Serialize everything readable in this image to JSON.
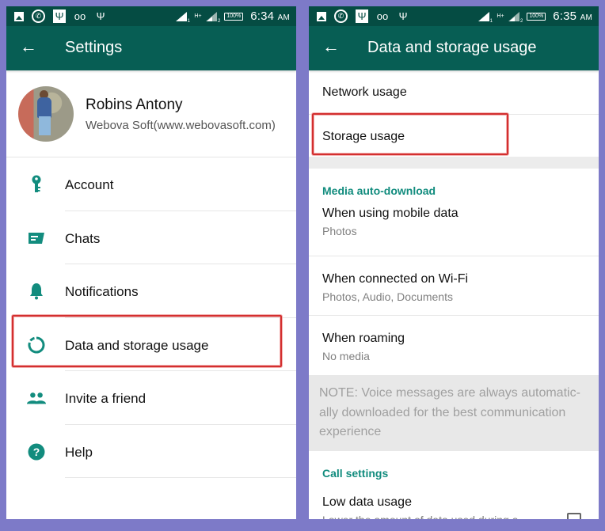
{
  "colors": {
    "background": "#7d7ac8",
    "status_bar": "#054c43",
    "app_bar": "#075e54",
    "accent": "#128c7e",
    "highlight": "#d32f2f"
  },
  "status_bar_left": {
    "icons": [
      "gallery-icon",
      "whatsapp-icon",
      "usb-icon",
      "voicemail-icon",
      "usb-icon"
    ],
    "time": "6:34",
    "ampm": "AM",
    "battery": "100%",
    "network": "H+"
  },
  "status_bar_right": {
    "time": "6:35",
    "ampm": "AM",
    "battery": "100%",
    "network": "H+"
  },
  "settings_screen": {
    "title": "Settings",
    "profile": {
      "name": "Robins Antony",
      "status": "Webova Soft(www.webovasoft.com)"
    },
    "items": [
      {
        "label": "Account",
        "icon": "key-icon"
      },
      {
        "label": "Chats",
        "icon": "chat-icon"
      },
      {
        "label": "Notifications",
        "icon": "bell-icon"
      },
      {
        "label": "Data and storage usage",
        "icon": "data-usage-icon",
        "highlighted": true
      },
      {
        "label": "Invite a friend",
        "icon": "people-icon"
      },
      {
        "label": "Help",
        "icon": "help-icon"
      }
    ]
  },
  "data_screen": {
    "title": "Data and storage usage",
    "network_usage": "Network usage",
    "storage_usage": "Storage usage",
    "media_section": "Media auto-download",
    "media_items": [
      {
        "title": "When using mobile data",
        "value": "Photos"
      },
      {
        "title": "When connected on Wi-Fi",
        "value": "Photos, Audio, Documents"
      },
      {
        "title": "When roaming",
        "value": "No media"
      }
    ],
    "note": "NOTE: Voice messages are always automatic-ally downloaded for the best communication experience",
    "call_section": "Call settings",
    "low_data": {
      "title": "Low data usage",
      "subtitle": "Lower the amount of data used during a",
      "checked": false
    }
  }
}
